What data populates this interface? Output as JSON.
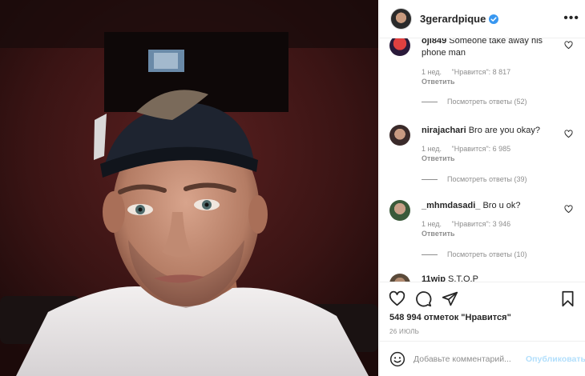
{
  "post": {
    "author": "3gerardpique",
    "more_label": "•••",
    "likes_text": "548 994 отметок \"Нравится\"",
    "date": "26 ИЮЛЬ",
    "comment_placeholder": "Добавьте комментарий...",
    "publish_label": "Опубликовать"
  },
  "comments": [
    {
      "user": "ojl849",
      "text": "Someone take away his phone man",
      "time": "1 нед.",
      "likes": "\"Нравится\": 8 817",
      "reply_label": "Ответить",
      "view_replies": "Посмотреть ответы (52)"
    },
    {
      "user": "nirajachari",
      "text": "Bro are you okay?",
      "time": "1 нед.",
      "likes": "\"Нравится\": 6 985",
      "reply_label": "Ответить",
      "view_replies": "Посмотреть ответы (39)"
    },
    {
      "user": "_mhmdasadi_",
      "text": "Bro u ok?",
      "time": "1 нед.",
      "likes": "\"Нравится\": 3 946",
      "reply_label": "Ответить",
      "view_replies": "Посмотреть ответы (10)"
    },
    {
      "user": "11wip",
      "text": "S.T.O.P"
    }
  ],
  "colors": {
    "verified": "#3897f0",
    "text": "#262626",
    "muted": "#8e8e8e",
    "publish": "#b2dffc"
  },
  "icons": {
    "like": "heart-icon",
    "comment": "comment-icon",
    "share": "share-icon",
    "save": "bookmark-icon",
    "emoji": "emoji-icon"
  }
}
